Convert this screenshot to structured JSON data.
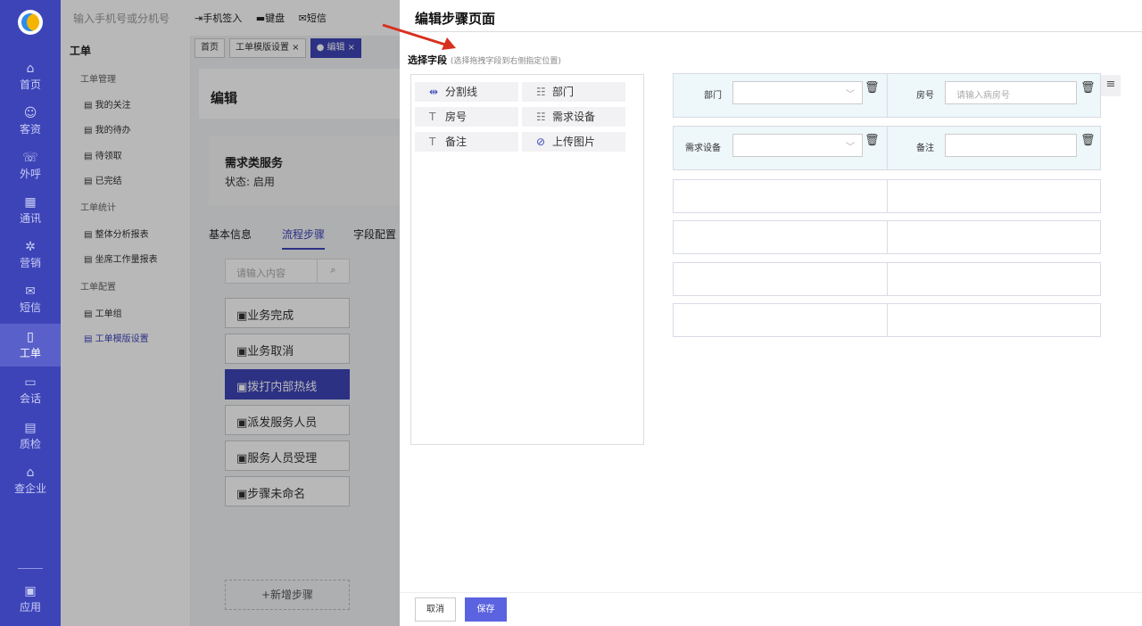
{
  "topbar": {
    "search_placeholder": "输入手机号或分机号",
    "signin": "手机签入",
    "keyboard": "键盘",
    "sms": "短信"
  },
  "nav": {
    "items": [
      {
        "label": "首页",
        "icon": "home-icon"
      },
      {
        "label": "客资",
        "icon": "users-icon"
      },
      {
        "label": "外呼",
        "icon": "phone-icon"
      },
      {
        "label": "通讯",
        "icon": "contacts-icon"
      },
      {
        "label": "营销",
        "icon": "marketing-icon"
      },
      {
        "label": "短信",
        "icon": "message-icon"
      },
      {
        "label": "工单",
        "icon": "clipboard-icon"
      },
      {
        "label": "会话",
        "icon": "chat-icon"
      },
      {
        "label": "质检",
        "icon": "inspect-icon"
      },
      {
        "label": "查企业",
        "icon": "building-icon"
      },
      {
        "label": "应用",
        "icon": "apps-icon"
      }
    ]
  },
  "subnav": {
    "title": "工单",
    "group1": "工单管理",
    "g1_items": [
      "我的关注",
      "我的待办",
      "待领取",
      "已完结"
    ],
    "group2": "工单统计",
    "g2_items": [
      "整体分析报表",
      "坐席工作量报表"
    ],
    "group3": "工单配置",
    "g3_items": [
      "工单组",
      "工单模版设置"
    ]
  },
  "main": {
    "crumbs": [
      "首页",
      "工单模版设置 ×",
      "● 编辑 ×"
    ],
    "edit_title": "编辑",
    "service_name": "需求类服务",
    "service_status": "状态:  启用",
    "tabs": [
      "基本信息",
      "流程步骤",
      "字段配置"
    ],
    "step_search_placeholder": "请输入内容",
    "steps": [
      "业务完成",
      "业务取消",
      "拨打内部热线",
      "派发服务人员",
      "服务人员受理",
      "步骤未命名"
    ],
    "add_step": "+新增步骤"
  },
  "drawer": {
    "title": "编辑步骤页面",
    "section_title": "选择字段",
    "section_hint": "(选择拖拽字段到右侧指定位置)",
    "palette": [
      {
        "label": "分割线",
        "icon": "divider-icon"
      },
      {
        "label": "部门",
        "icon": "select-icon"
      },
      {
        "label": "房号",
        "icon": "text-icon"
      },
      {
        "label": "需求设备",
        "icon": "select-icon"
      },
      {
        "label": "备注",
        "icon": "text-icon"
      },
      {
        "label": "上传图片",
        "icon": "attachment-icon"
      }
    ],
    "row1": {
      "left_label": "部门",
      "right_label": "房号",
      "right_placeholder": "请输入病房号"
    },
    "row2": {
      "left_label": "需求设备",
      "right_label": "备注"
    },
    "cancel": "取消",
    "save": "保存"
  },
  "colors": {
    "brand": "#3d44b8",
    "save_button": "#5b63e0",
    "arrow": "#d8301f"
  }
}
